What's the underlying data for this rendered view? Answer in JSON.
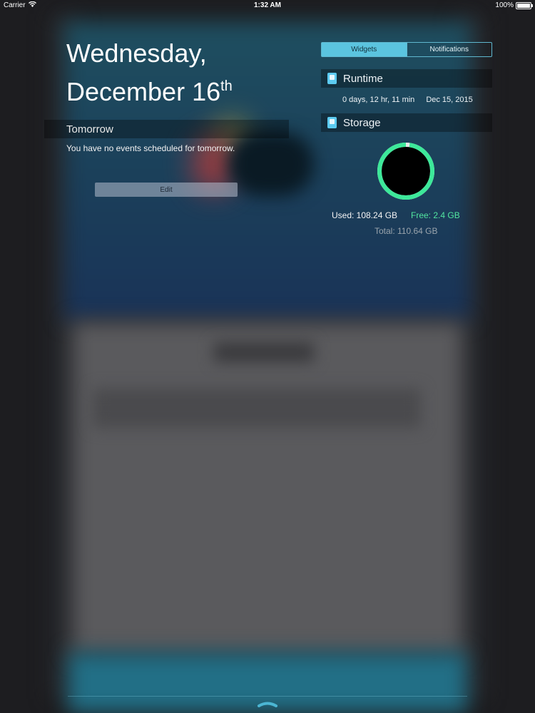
{
  "status_bar": {
    "carrier": "Carrier",
    "time": "1:32 AM",
    "battery": "100%"
  },
  "date": {
    "line1": "Wednesday,",
    "line2": "December 16",
    "suffix": "th"
  },
  "today": {
    "tomorrow_title": "Tomorrow",
    "no_events": "You have no events scheduled for tomorrow.",
    "edit_label": "Edit"
  },
  "segmented": {
    "widgets": "Widgets",
    "notifications": "Notifications",
    "selected": "Widgets"
  },
  "runtime": {
    "title": "Runtime",
    "duration": "0 days, 12 hr, 11 min",
    "date": "Dec 15, 2015"
  },
  "storage": {
    "title": "Storage",
    "used": "Used: 108.24 GB",
    "free": "Free: 2.4 GB",
    "total": "Total: 110.64 GB",
    "used_fraction": 0.978,
    "ring_color": "#3de89a",
    "free_color": "#52e6a0"
  },
  "icons": {
    "wifi": "wifi-icon",
    "battery": "battery-icon",
    "widget": "widget-app-icon",
    "grabber": "chevron-up-icon"
  }
}
